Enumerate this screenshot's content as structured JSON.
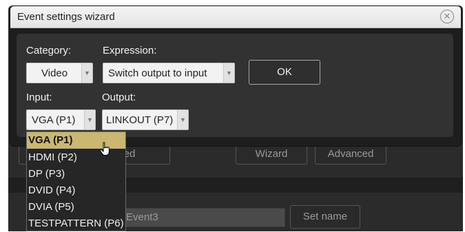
{
  "dialog": {
    "title": "Event settings wizard",
    "close_glyph": "✕",
    "category_label": "Category:",
    "category_value": "Video",
    "expression_label": "Expression:",
    "expression_value": "Switch output to input",
    "ok_label": "OK",
    "input_label": "Input:",
    "input_value": "VGA (P1)",
    "output_label": "Output:",
    "output_value": "LINKOUT (P7)"
  },
  "input_dropdown": {
    "options": [
      "VGA (P1)",
      "HDMI (P2)",
      "DP (P3)",
      "DVID (P4)",
      "DVIA (P5)",
      "TESTPATTERN (P6)"
    ],
    "selected_index": 0
  },
  "background": {
    "advanced_left_label": "vanced",
    "wizard_label": "Wizard",
    "advanced_label": "Advanced",
    "event_name_value": "Event3",
    "set_name_label": "Set name"
  },
  "icons": {
    "close": "close-icon",
    "dropdown_arrow": "chevron-down-icon",
    "cursor": "hand-pointer-icon"
  }
}
